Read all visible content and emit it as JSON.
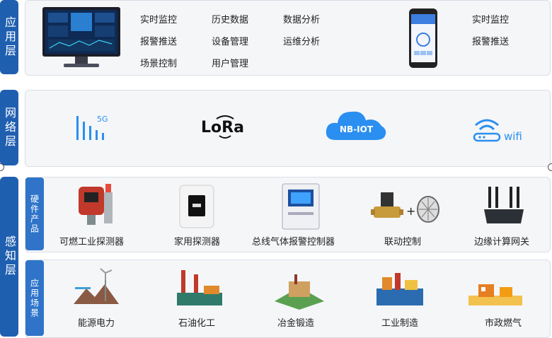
{
  "layers": {
    "application": {
      "label": "应用层"
    },
    "network": {
      "label": "网络层"
    },
    "perception": {
      "label": "感知层"
    }
  },
  "app_layer": {
    "pc_functions": [
      "实时监控",
      "历史数据",
      "数据分析",
      "报警推送",
      "设备管理",
      "运维分析",
      "场景控制",
      "用户管理"
    ],
    "mobile_functions": [
      "实时监控",
      "报警推送"
    ]
  },
  "network_layer": {
    "items": [
      {
        "icon": "5g-signal-icon",
        "label": "5G"
      },
      {
        "icon": "lora-logo-icon",
        "label": "LoRa"
      },
      {
        "icon": "nb-iot-cloud-icon",
        "label": "NB-IOT"
      },
      {
        "icon": "wifi-router-icon",
        "label": "wifi"
      }
    ]
  },
  "perception_layer": {
    "hardware": {
      "label": "硬件产品",
      "items": [
        "可燃工业探测器",
        "家用探测器",
        "总线气体报警控制器",
        "联动控制",
        "边缘计算网关"
      ],
      "plus": "+"
    },
    "scenes": {
      "label": "应用场景",
      "items": [
        "能源电力",
        "石油化工",
        "冶金锻造",
        "工业制造",
        "市政燃气"
      ]
    }
  },
  "colors": {
    "layer_bar": "#1f5fb0",
    "sub_bar": "#2f74c9",
    "panel_bg": "#f5f6f8",
    "accent": "#2a8ff0"
  }
}
